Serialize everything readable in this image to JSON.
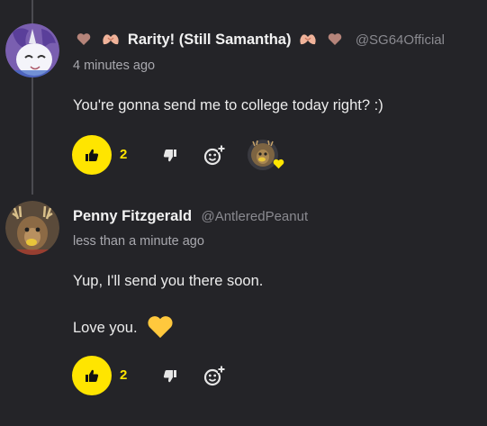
{
  "comments": [
    {
      "author": "Rarity! (Still Samantha)",
      "handle": "@SG64Official",
      "timestamp": "4 minutes ago",
      "lines": [
        "You're gonna send me to college today right? :)"
      ],
      "likes": "2"
    },
    {
      "author": "Penny Fitzgerald",
      "handle": "@AntleredPeanut",
      "timestamp": "less than a minute ago",
      "lines": [
        "Yup, I'll send you there soon.",
        "Love you."
      ],
      "likes": "2"
    }
  ],
  "colors": {
    "accent": "#ffe500",
    "background": "#242428",
    "text": "#ececec",
    "muted": "#8a8a90",
    "brown_heart": "#b5847a",
    "hand_pink": "#f0b39a",
    "heart_yellow": "#ffc83d"
  },
  "icons": {
    "header_emoji": [
      "brown-heart-icon",
      "heart-hands-icon"
    ],
    "actions": [
      "thumbs-up-icon",
      "thumbs-down-icon",
      "add-reaction-icon"
    ],
    "reaction": "yellow-heart-icon"
  }
}
